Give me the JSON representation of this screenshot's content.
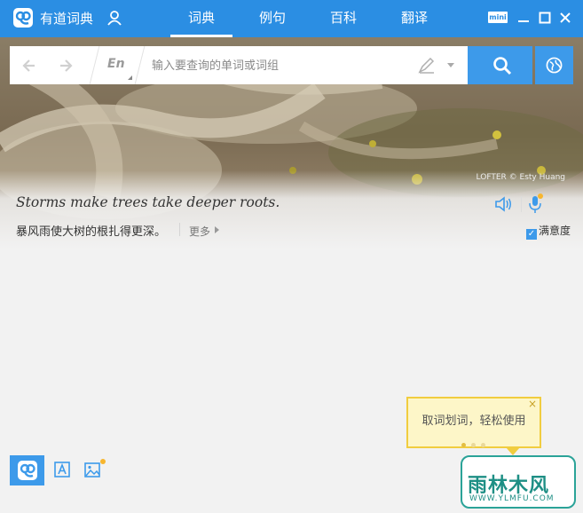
{
  "app": {
    "title": "有道词典"
  },
  "nav": {
    "tabs": [
      {
        "label": "词典",
        "active": true
      },
      {
        "label": "例句",
        "active": false
      },
      {
        "label": "百科",
        "active": false
      },
      {
        "label": "翻译",
        "active": false
      }
    ]
  },
  "window_controls": {
    "mini_label": "mini"
  },
  "search": {
    "lang_label": "En",
    "placeholder": "输入要查询的单词或词组",
    "value": ""
  },
  "banner": {
    "photo_credit": "LOFTER © Esty Huang"
  },
  "daily": {
    "sentence_en": "Storms make trees take deeper roots.",
    "sentence_cn": "暴风雨使大树的根扎得更深。",
    "more_label": "更多",
    "satisfaction_label": "满意度",
    "satisfaction_checked": true
  },
  "tooltip": {
    "text": "取词划词，轻松使用",
    "close": "×",
    "dots": 3,
    "active_dot": 0
  },
  "watermark": {
    "text": "雨林木风",
    "url": "WWW.YLMFU.COM"
  },
  "colors": {
    "brand_blue": "#2b8ee3",
    "button_blue": "#3d9aea",
    "tooltip_bg": "#fdf6c8",
    "tooltip_border": "#f1cd3f",
    "badge_dot": "#f7b62f"
  },
  "icons": {
    "logo": "youdao-logo-icon",
    "user": "user-icon",
    "back": "arrow-left-icon",
    "forward": "arrow-right-icon",
    "handwriting": "pen-icon",
    "search": "search-icon",
    "globe": "globe-icon",
    "speaker": "speaker-icon",
    "mic": "microphone-icon",
    "ocr": "screen-capture-icon",
    "image": "image-translate-icon"
  }
}
